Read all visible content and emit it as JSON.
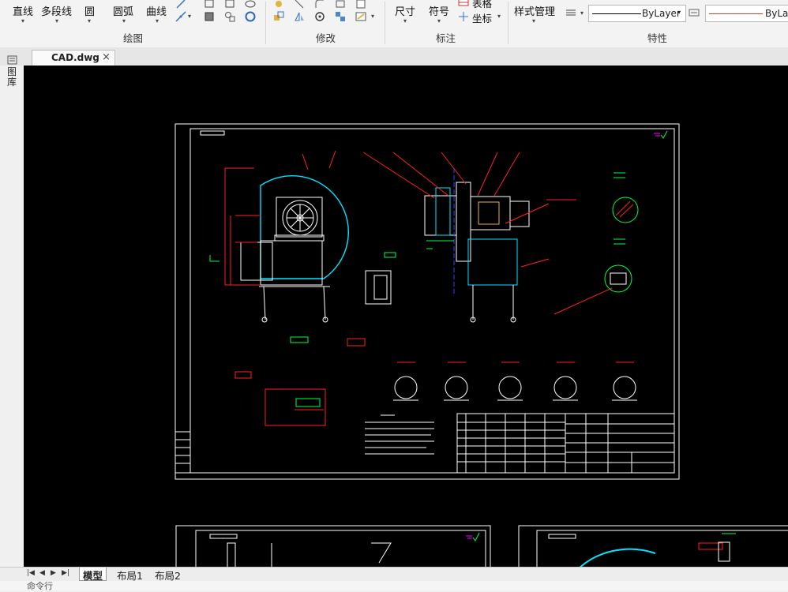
{
  "ribbon": {
    "draw": {
      "line_label": "直线",
      "polyline_label": "多段线",
      "circle_label": "圆",
      "arc_label": "圆弧",
      "curve_label": "曲线",
      "group_label": "绘图"
    },
    "modify": {
      "group_label": "修改"
    },
    "annotate": {
      "dimension_label": "尺寸",
      "symbol_label": "符号",
      "table_label": "表格",
      "coordinate_label": "坐标",
      "group_label": "标注"
    },
    "properties": {
      "style_manager_label": "样式管理",
      "layer_value": "ByLayer",
      "linetype_value": "ByLay",
      "group_label": "特性"
    }
  },
  "document": {
    "tab_label": "CAD.dwg",
    "close_glyph": "×"
  },
  "left_panel": {
    "label": "图库"
  },
  "layout_tabs": [
    {
      "label": "模型",
      "active": true
    },
    {
      "label": "布局1",
      "active": false
    },
    {
      "label": "布局2",
      "active": false
    }
  ],
  "command_line": {
    "prompt": "命令行"
  },
  "colors": {
    "canvas": "#000000",
    "frame": "#ffffff",
    "red": "#ff2020",
    "cyan": "#00e5ff",
    "green": "#00ff40",
    "magenta": "#ff00ff",
    "blue": "#3344ff"
  },
  "icons": [
    "properties-icon",
    "close-icon",
    "first-icon",
    "prev-icon",
    "next-icon",
    "last-icon",
    "lineweight-icon"
  ]
}
